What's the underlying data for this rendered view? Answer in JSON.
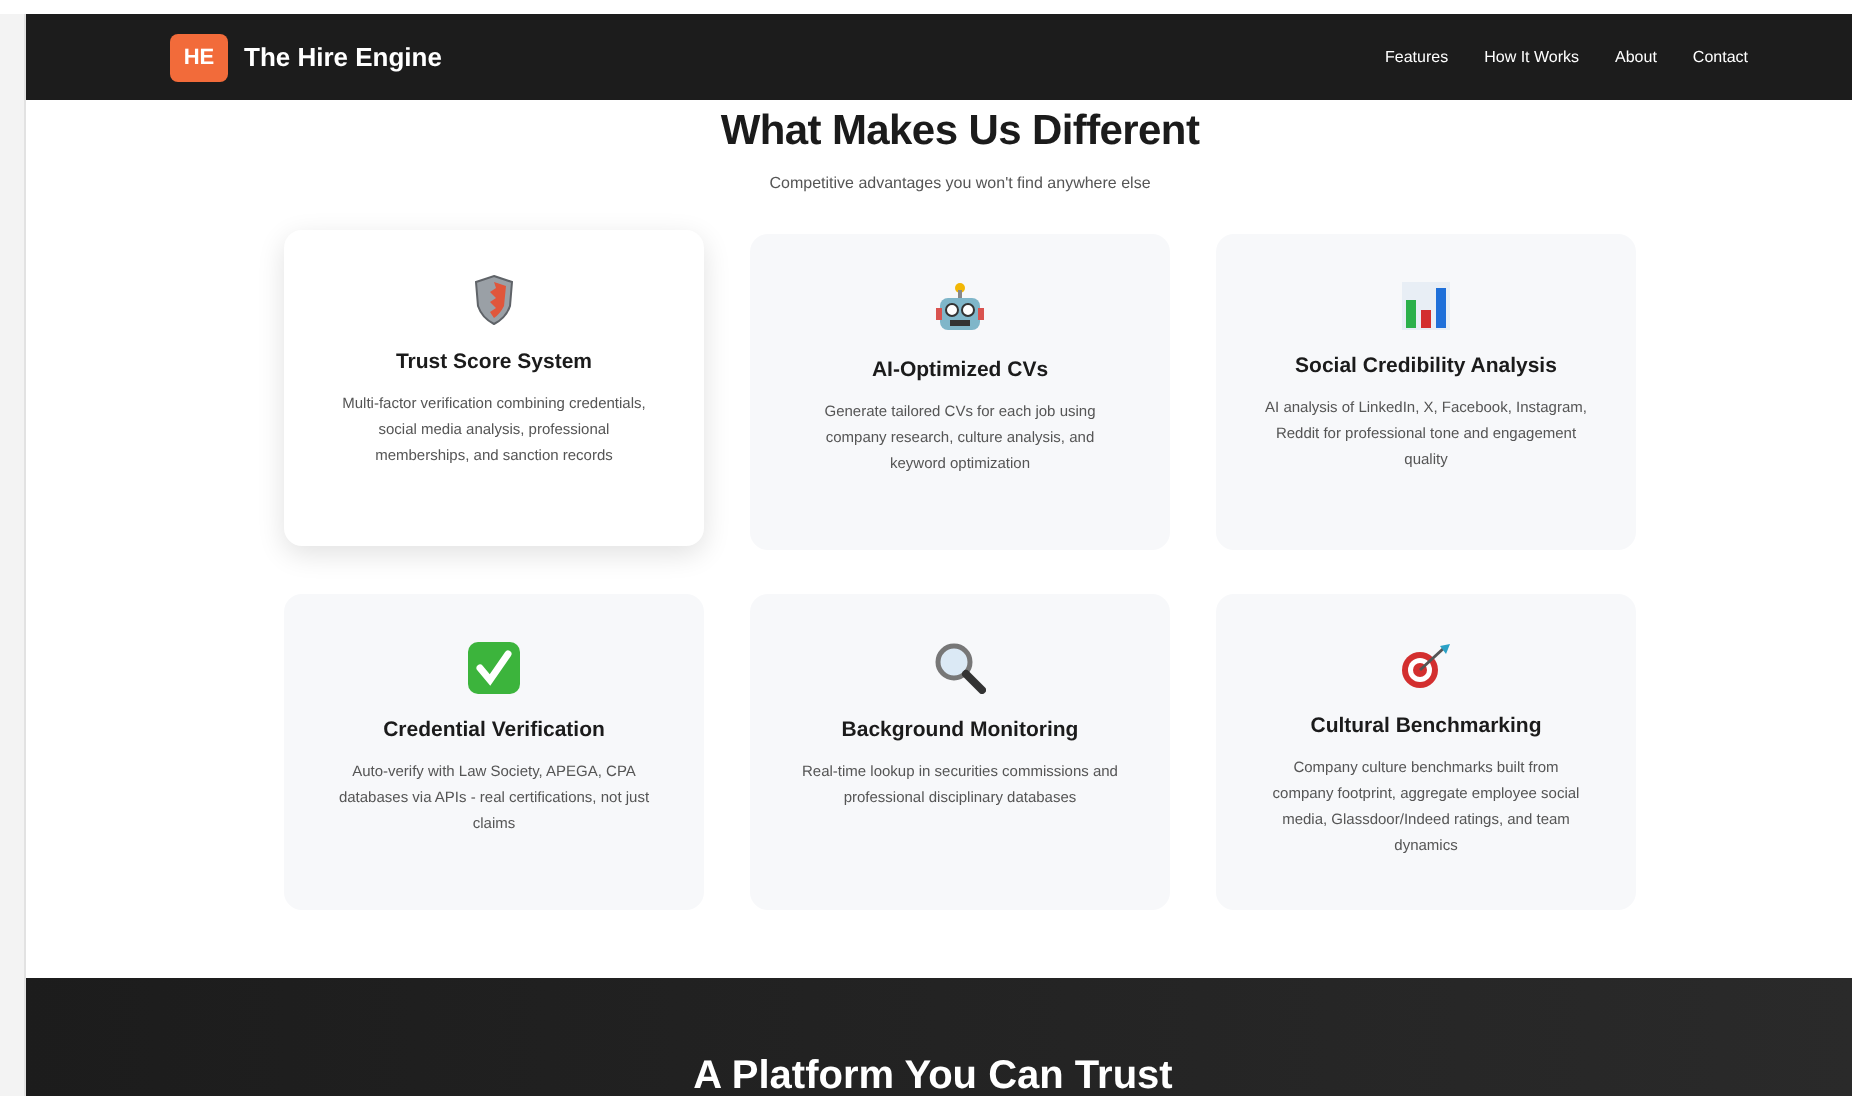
{
  "navbar": {
    "logo_badge": "HE",
    "brand": "The Hire Engine",
    "links": [
      "Features",
      "How It Works",
      "About",
      "Contact"
    ]
  },
  "features": {
    "title": "What Makes Us Different",
    "subtitle": "Competitive advantages you won't find anywhere else",
    "cards": [
      {
        "title": "Trust Score System",
        "description": "Multi-factor verification combining credentials, social media analysis, professional memberships, and sanction records",
        "raised": true
      },
      {
        "title": "AI-Optimized CVs",
        "description": "Generate tailored CVs for each job using company research, culture analysis, and keyword optimization",
        "raised": false
      },
      {
        "title": "Social Credibility Analysis",
        "description": "AI analysis of LinkedIn, X, Facebook, Instagram, Reddit for professional tone and engagement quality",
        "raised": false
      },
      {
        "title": "Credential Verification",
        "description": "Auto-verify with Law Society, APEGA, CPA databases via APIs - real certifications, not just claims",
        "raised": false
      },
      {
        "title": "Background Monitoring",
        "description": "Real-time lookup in securities commissions and professional disciplinary databases",
        "raised": false
      },
      {
        "title": "Cultural Benchmarking",
        "description": "Company culture benchmarks built from company footprint, aggregate employee social media, Glassdoor/Indeed ratings, and team dynamics",
        "raised": false
      }
    ]
  },
  "trust_section": {
    "title": "A Platform You Can Trust"
  }
}
